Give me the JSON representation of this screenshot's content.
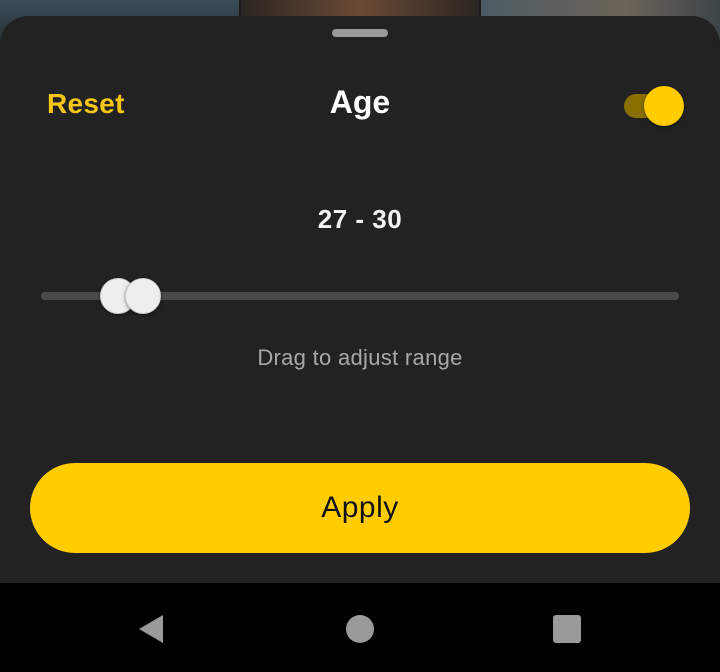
{
  "sheet": {
    "reset_label": "Reset",
    "title": "Age",
    "filter_enabled": true,
    "range_text": "27 - 30",
    "hint": "Drag to adjust range",
    "apply_label": "Apply"
  },
  "slider": {
    "min_fraction": 0.12,
    "max_fraction": 0.16
  },
  "colors": {
    "accent": "#ffcc00",
    "sheet_background": "#222222",
    "text_primary": "#ffffff",
    "text_secondary": "#a8a8a8"
  },
  "navigation": {
    "back_icon": "back-triangle-icon",
    "home_icon": "home-circle-icon",
    "recents_icon": "recents-square-icon"
  }
}
